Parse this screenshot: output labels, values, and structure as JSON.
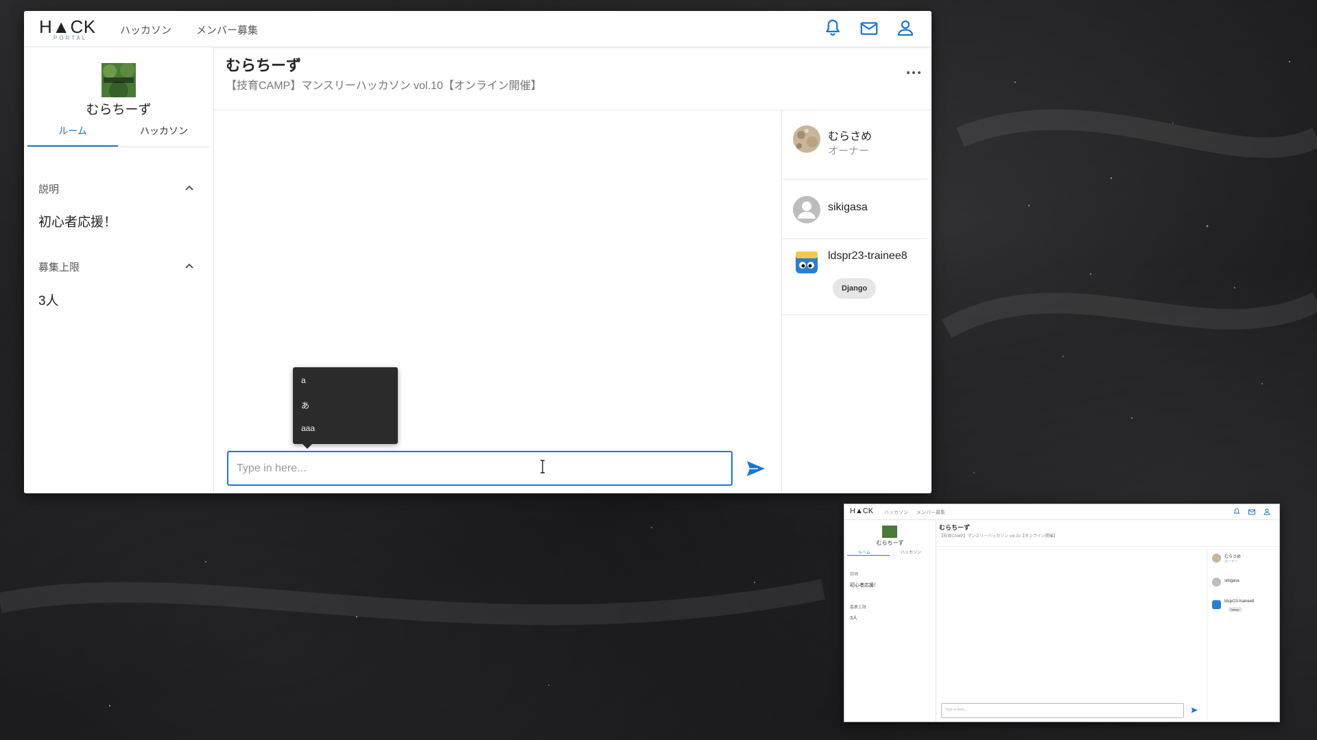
{
  "app": {
    "logo_text": "H▲CK",
    "logo_sub": "PORTAL",
    "nav": {
      "hackathon": "ハッカソン",
      "recruit": "メンバー募集"
    },
    "icons": [
      "bell-icon",
      "mail-icon",
      "user-icon"
    ]
  },
  "sidebar": {
    "room_name": "むらちーず",
    "thumb_caption": "マンスリーハッカソン",
    "tabs": {
      "room": "ルーム",
      "hackathon": "ハッカソン"
    },
    "description_label": "説明",
    "description_value": "初心者応援！",
    "limit_label": "募集上限",
    "limit_value": "3人"
  },
  "chat": {
    "title": "むらちーず",
    "subtitle": "【技育CAMP】マンスリーハッカソン vol.10【オンライン開催】",
    "input_placeholder": "Type in here...",
    "popup_items": [
      "a",
      "あ",
      "aaa"
    ]
  },
  "members": [
    {
      "name": "むらさめ",
      "role": "オーナー"
    },
    {
      "name": "sikigasa"
    },
    {
      "name": "ldspr23-trainee8",
      "skill": "Django"
    }
  ],
  "colors": {
    "accent": "#1976d2",
    "popup_bg": "#2b2b2b"
  }
}
